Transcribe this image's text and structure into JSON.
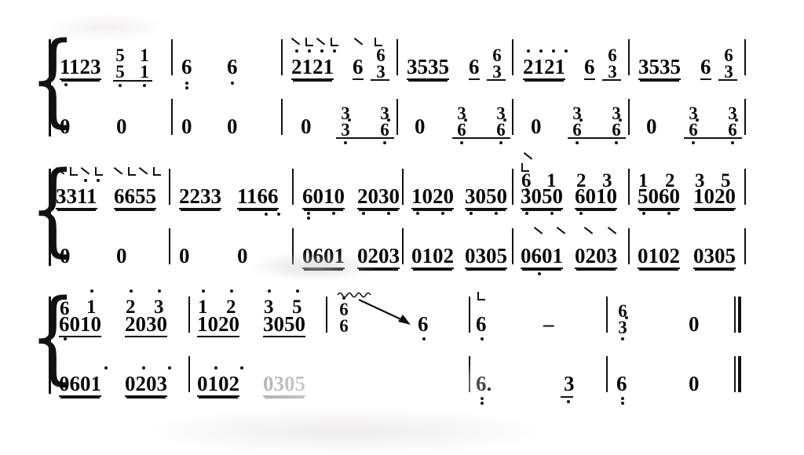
{
  "document": {
    "type": "jianpu-numbered-notation",
    "instrument": "guzheng",
    "systems": 3,
    "staves_per_system": 2
  },
  "colors": {
    "ink": "#0a0a0a",
    "paper": "#ffffff"
  },
  "symbols": {
    "barline": "|",
    "final_barline": "||",
    "brace": "{",
    "hold_dash": "-",
    "rest": "0",
    "fingering_slash": "\\",
    "fingering_ell": "L",
    "tremolo": "~~~",
    "gliss_arrow": "arrow"
  },
  "system1": {
    "upper": {
      "measures": [
        {
          "notes": "1123",
          "second": "5 1 / 5 1",
          "group1": "1123",
          "group2_top": "5  1",
          "group2_bottom": "5  1"
        },
        {
          "notes": "6   6"
        },
        {
          "group": "2121",
          "chord_top": "6",
          "chord_bottom": "3",
          "single": "6",
          "fingering": "\\L\\L  \\  L"
        },
        {
          "group": "3535",
          "chord_top": "6",
          "chord_bottom": "3",
          "single": "6"
        },
        {
          "group": "2121",
          "chord_top": "6",
          "chord_bottom": "3",
          "single": "6"
        },
        {
          "group": "3535",
          "chord_top": "6",
          "chord_bottom": "3",
          "single": "6"
        }
      ]
    },
    "lower": {
      "measures": [
        {
          "notes": "0   0"
        },
        {
          "notes": "0   0"
        },
        {
          "rest": "0",
          "chord1_top": "3",
          "chord1_bottom": "3",
          "chord2_top": "3",
          "chord2_bottom": "6"
        },
        {
          "rest": "0",
          "chord1_top": "3",
          "chord1_bottom": "6",
          "chord2_top": "3",
          "chord2_bottom": "6"
        },
        {
          "rest": "0",
          "chord1_top": "3",
          "chord1_bottom": "6",
          "chord2_top": "3",
          "chord2_bottom": "6"
        },
        {
          "rest": "0",
          "chord1_top": "3",
          "chord1_bottom": "6",
          "chord2_top": "3",
          "chord2_bottom": "6"
        }
      ]
    }
  },
  "system2": {
    "upper": {
      "measures": [
        {
          "g1": "3311",
          "g2": "6655",
          "fingering": "\\L\\L  \\L\\L"
        },
        {
          "g1": "2233",
          "g2": "1166"
        },
        {
          "g1": "6010",
          "g2": "2030"
        },
        {
          "g1": "1020",
          "g2": "3050"
        },
        {
          "top": "6  1      2  3",
          "g1": "3050",
          "g2": "6010",
          "fingering": "\\ L"
        },
        {
          "top": "1  2      3  5",
          "g1": "5060",
          "g2": "1020"
        }
      ]
    },
    "lower": {
      "measures": [
        {
          "notes": "0   0"
        },
        {
          "notes": "0   0"
        },
        {
          "g1": "0601",
          "g2": "0203"
        },
        {
          "g1": "0102",
          "g2": "0305"
        },
        {
          "g1": "0601",
          "g2": "0203",
          "fingering": "\\  \\   \\  \\"
        },
        {
          "g1": "0102",
          "g2": "0305"
        }
      ]
    }
  },
  "system3": {
    "upper": {
      "measures": [
        {
          "c1_top": "6",
          "c1_bot": "6",
          "g1": "6010",
          "c2_top": "1",
          "c2_bot": "1",
          "c3_top": "2",
          "c3_bot": "2",
          "g2": "2030",
          "c4_top": "3",
          "c4_bot": "3"
        },
        {
          "c1_top": "1",
          "c1_bot": "1",
          "g1": "1020",
          "c2_top": "2",
          "c2_bot": "2",
          "c3_top": "3",
          "c3_bot": "3",
          "g2": "3050",
          "c4_top": "5",
          "c4_bot": "5"
        },
        {
          "tremolo_chord_top": "6",
          "tremolo_chord_bottom": "6",
          "gliss_target": "6"
        },
        {
          "note": "6",
          "fingering": "L",
          "hold": "-"
        },
        {
          "chord_top": "6",
          "chord_bottom": "3",
          "rest": "0"
        }
      ]
    },
    "lower": {
      "measures": [
        {
          "g1": "0601",
          "g2": "0203"
        },
        {
          "g1": "0102",
          "g2": "0305"
        },
        {
          "note": "6.",
          "second": "3"
        },
        {
          "note": "6",
          "rest": "0"
        }
      ]
    }
  }
}
